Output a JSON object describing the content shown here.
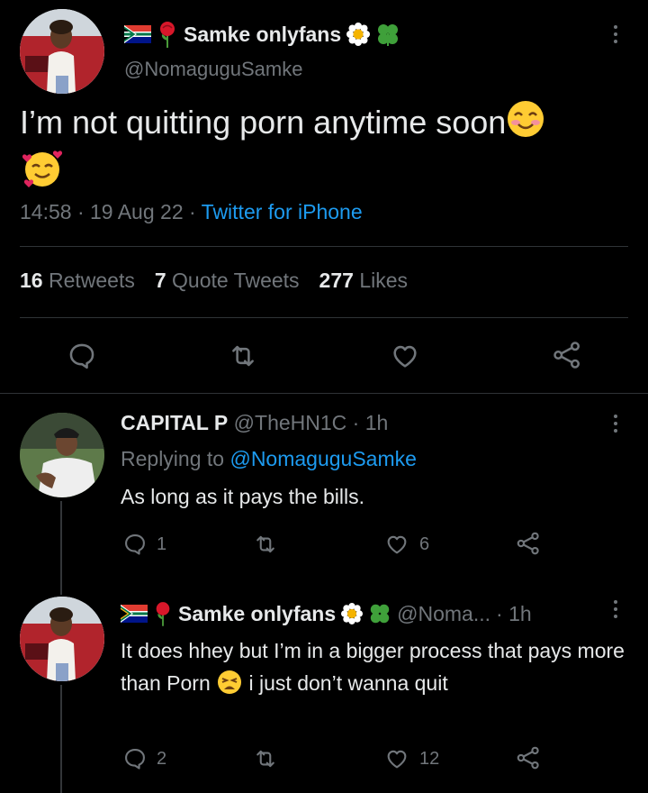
{
  "main_tweet": {
    "display_name": "Samke onlyfans",
    "handle": "@NomaguguSamke",
    "text": "I’m not quitting porn anytime soon",
    "time": "14:58",
    "date": "19 Aug 22",
    "source": "Twitter for iPhone",
    "sep": "·",
    "stats": {
      "retweets_count": "16",
      "retweets_label": "Retweets",
      "quotes_count": "7",
      "quotes_label": "Quote Tweets",
      "likes_count": "277",
      "likes_label": "Likes"
    }
  },
  "reply1": {
    "display_name": "CAPITAL P",
    "handle": "@TheHN1C",
    "time": "· 1h",
    "replying_prefix": "Replying to",
    "replying_handle": "@NomaguguSamke",
    "text": "As long as it pays the bills.",
    "reply_count": "1",
    "like_count": "6"
  },
  "reply2": {
    "display_name": "Samke onlyfans",
    "handle": "@Noma...",
    "time": "· 1h",
    "text_part1": "It does hhey but I’m in a bigger process that pays more than Porn",
    "text_part2": "i just don’t wanna quit",
    "reply_count": "2",
    "like_count": "12"
  },
  "colors": {
    "background": "#000000",
    "text": "#e7e9ea",
    "muted": "#71767b",
    "link": "#1d9bf0",
    "divider": "#2f3336"
  },
  "icons": [
    "south-africa-flag-icon",
    "rose-icon",
    "flower-icon",
    "clover-icon",
    "smiling-blush-icon",
    "smiling-hearts-icon",
    "weary-face-icon",
    "reply-icon",
    "retweet-icon",
    "like-icon",
    "share-icon",
    "more-icon"
  ]
}
